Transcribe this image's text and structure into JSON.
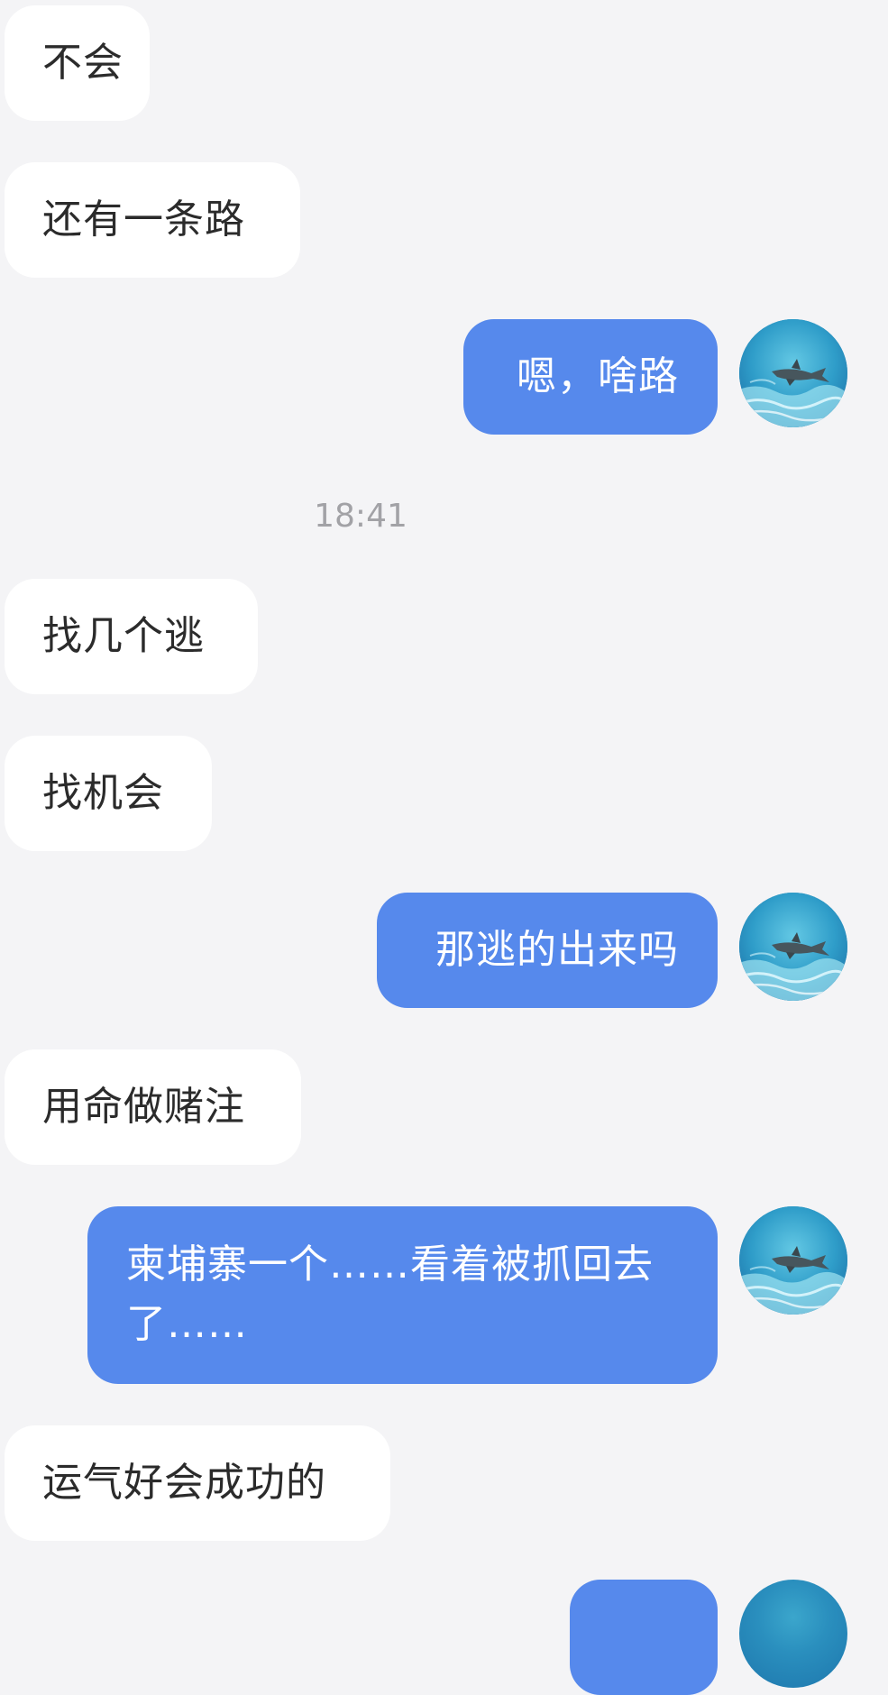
{
  "conversation": {
    "messages": [
      {
        "side": "incoming",
        "text": "不会"
      },
      {
        "side": "incoming",
        "text": "还有一条路"
      },
      {
        "side": "outgoing",
        "text": "嗯，啥路"
      },
      {
        "side": "timestamp",
        "text": "18:41"
      },
      {
        "side": "incoming",
        "text": "找几个逃"
      },
      {
        "side": "incoming",
        "text": "找机会"
      },
      {
        "side": "outgoing",
        "text": "那逃的出来吗"
      },
      {
        "side": "incoming",
        "text": "用命做赌注"
      },
      {
        "side": "outgoing",
        "text": "柬埔寨一个……看着被抓回去了……"
      },
      {
        "side": "incoming",
        "text": "运气好会成功的"
      }
    ]
  },
  "avatar": {
    "icon": "shark-underwater-avatar-icon"
  },
  "colors": {
    "background": "#f4f4f6",
    "incoming_bubble": "#ffffff",
    "outgoing_bubble": "#5689ec",
    "incoming_text": "#2b2b2b",
    "outgoing_text": "#ffffff",
    "timestamp_text": "#a2a2a6"
  }
}
